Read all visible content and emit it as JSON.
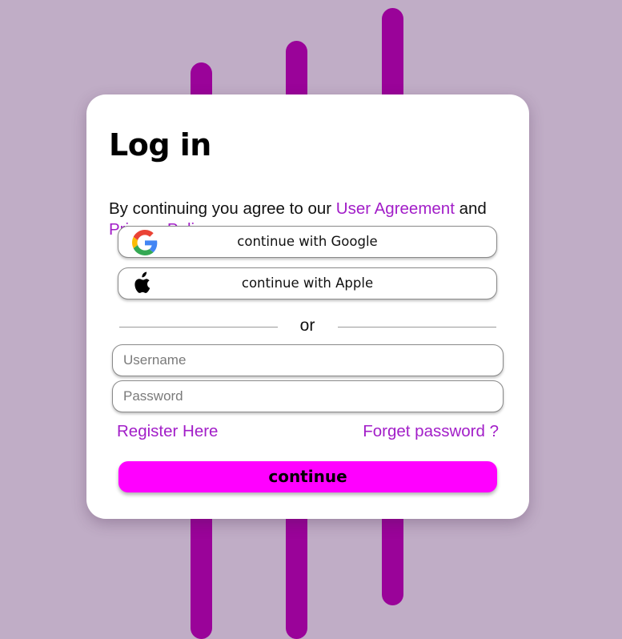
{
  "colors": {
    "background": "#c0adc6",
    "bars": "#9a0399",
    "link": "#a21ec8",
    "primary_button": "#ff00ff",
    "card": "#ffffff"
  },
  "login": {
    "title": "Log in",
    "agreement": {
      "prefix": "By continuing you agree to our ",
      "user_agreement": "User Agreement",
      "middle": " and",
      "privacy_policy": "Privacy Policy"
    },
    "google_button": {
      "label": "continue with Google",
      "icon": "google-icon"
    },
    "apple_button": {
      "label": "continue with Apple",
      "icon": "apple-icon"
    },
    "divider_text": "or",
    "username": {
      "placeholder": "Username",
      "value": ""
    },
    "password": {
      "placeholder": "Password",
      "value": ""
    },
    "register_link": "Register Here",
    "forget_link": "Forget password ?",
    "submit_label": "continue"
  }
}
